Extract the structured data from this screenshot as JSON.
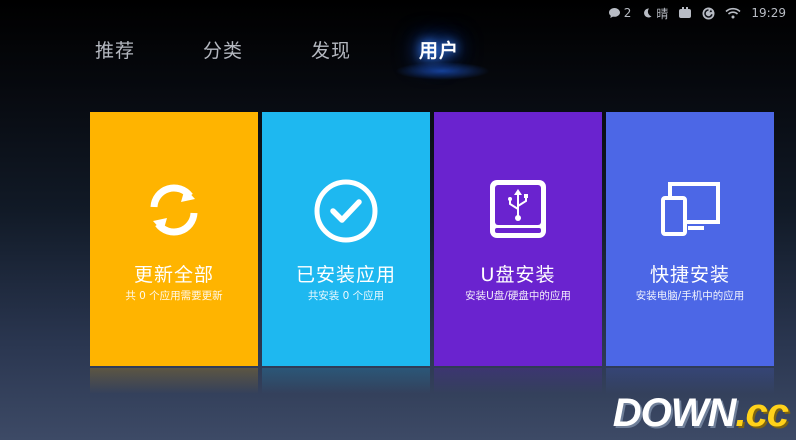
{
  "status_bar": {
    "message_count": "2",
    "weather": "晴",
    "time": "19:29"
  },
  "tabs": [
    {
      "label": "推荐",
      "active": false
    },
    {
      "label": "分类",
      "active": false
    },
    {
      "label": "发现",
      "active": false
    },
    {
      "label": "用户",
      "active": true
    }
  ],
  "cards": [
    {
      "title": "更新全部",
      "subtitle": "共 0 个应用需要更新",
      "color": "#ffb400",
      "icon": "refresh-icon"
    },
    {
      "title": "已安装应用",
      "subtitle": "共安装 0 个应用",
      "color": "#1eb8f0",
      "icon": "check-circle-icon"
    },
    {
      "title": "U盘安装",
      "subtitle": "安装U盘/硬盘中的应用",
      "color": "#6a23cf",
      "icon": "usb-drive-icon"
    },
    {
      "title": "快捷安装",
      "subtitle": "安装电脑/手机中的应用",
      "color": "#4c67e6",
      "icon": "devices-icon"
    }
  ],
  "watermark": {
    "part1": "DOWN",
    "part2": ".cc"
  }
}
